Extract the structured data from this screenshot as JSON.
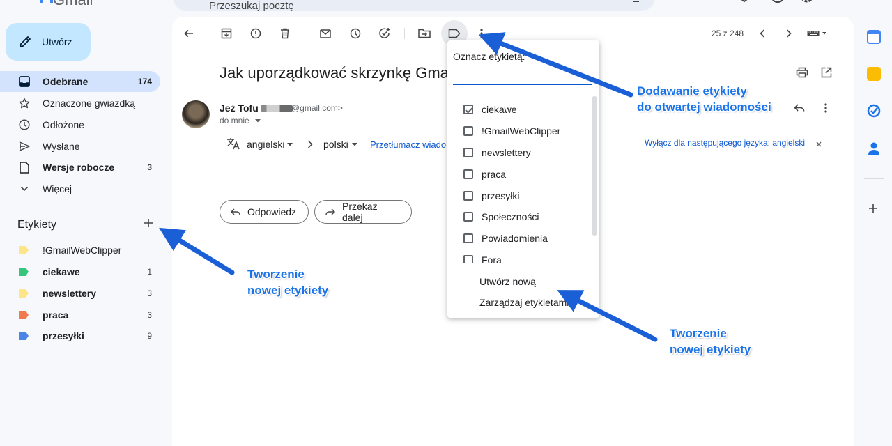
{
  "app": {
    "logo_text": "Gmail"
  },
  "search": {
    "placeholder": "Przeszukaj pocztę"
  },
  "compose": {
    "label": "Utwórz"
  },
  "nav": [
    {
      "label": "Odebrane",
      "count": "174"
    },
    {
      "label": "Oznaczone gwiazdką",
      "count": ""
    },
    {
      "label": "Odłożone",
      "count": ""
    },
    {
      "label": "Wysłane",
      "count": ""
    },
    {
      "label": "Wersje robocze",
      "count": "3"
    },
    {
      "label": "Więcej",
      "count": ""
    }
  ],
  "labels": {
    "title": "Etykiety",
    "items": [
      {
        "name": "!GmailWebClipper",
        "count": "",
        "color": "#fde68a"
      },
      {
        "name": "ciekawe",
        "count": "1",
        "color": "#34c77b"
      },
      {
        "name": "newslettery",
        "count": "3",
        "color": "#fde68a"
      },
      {
        "name": "praca",
        "count": "3",
        "color": "#f07b4f"
      },
      {
        "name": "przesyłki",
        "count": "9",
        "color": "#4a86e8"
      }
    ]
  },
  "toolbar": {
    "pager": "25 z 248"
  },
  "message": {
    "subject": "Jak uporządkować skrzynkę Gmail",
    "sender_name": "Jeż Tofu",
    "sender_email": "@gmail.com>",
    "to": "do mnie",
    "translate": {
      "from_lang": "angielski",
      "to_lang": "polski",
      "translate_link": "Przetłumacz wiadom",
      "disable_link": "Wyłącz dla następującego języka: angielski"
    },
    "reply_label": "Odpowiedz",
    "forward_label": "Przekaż dalej"
  },
  "label_menu": {
    "title": "Oznacz etykietą:",
    "items": [
      {
        "name": "ciekawe",
        "checked": true
      },
      {
        "name": "!GmailWebClipper",
        "checked": false
      },
      {
        "name": "newslettery",
        "checked": false
      },
      {
        "name": "praca",
        "checked": false
      },
      {
        "name": "przesyłki",
        "checked": false
      },
      {
        "name": "Społeczności",
        "checked": false
      },
      {
        "name": "Powiadomienia",
        "checked": false
      },
      {
        "name": "Fora",
        "checked": false
      }
    ],
    "create_new": "Utwórz nową",
    "manage": "Zarządzaj etykietami"
  },
  "callouts": {
    "add_label": [
      "Dodawanie etykiety",
      "do otwartej wiadomości"
    ],
    "create_label_sidebar": [
      "Tworzenie",
      "nowej etykiety"
    ],
    "create_label_menu": [
      "Tworzenie",
      "nowej etykiety"
    ]
  },
  "colors": {
    "accent": "#1a73e8",
    "active_nav": "#d3e3fd",
    "compose": "#c2e7ff"
  }
}
